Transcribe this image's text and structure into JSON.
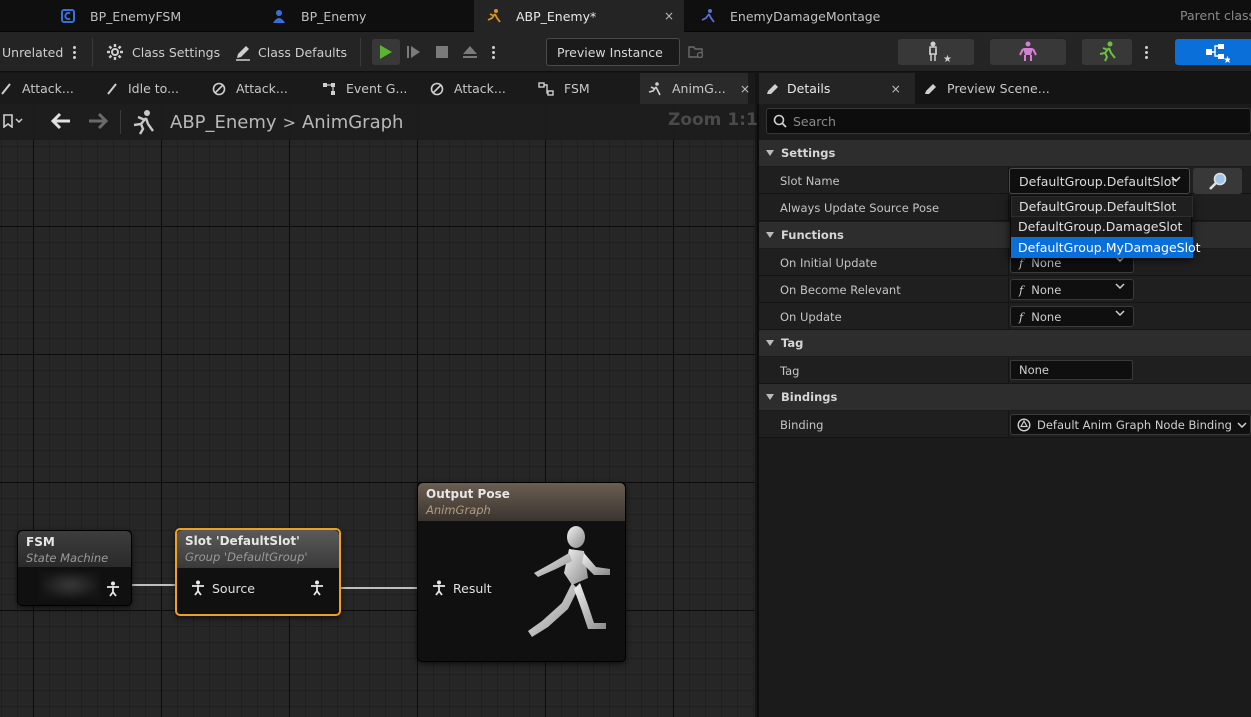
{
  "doc_tabs": [
    {
      "label": "BP_EnemyFSM"
    },
    {
      "label": "BP_Enemy"
    },
    {
      "label": "ABP_Enemy*",
      "close": "×"
    },
    {
      "label": "EnemyDamageMontage"
    }
  ],
  "parent_class": "Parent class",
  "toolbar": {
    "unrelated": "Unrelated",
    "class_settings": "Class Settings",
    "class_defaults": "Class Defaults",
    "preview_instance": "Preview Instance"
  },
  "graph_tabs": [
    {
      "label": "Attack..."
    },
    {
      "label": "Idle to..."
    },
    {
      "label": "Attack..."
    },
    {
      "label": "Event G..."
    },
    {
      "label": "Attack..."
    },
    {
      "label": "FSM"
    },
    {
      "label": "AnimG...",
      "close": "×"
    }
  ],
  "breadcrumb": {
    "root": "ABP_Enemy",
    "sep": ">",
    "leaf": "AnimGraph"
  },
  "zoom": "Zoom 1:1",
  "nodes": {
    "fsm": {
      "title": "FSM",
      "subtitle": "State Machine"
    },
    "slot": {
      "title": "Slot 'DefaultSlot'",
      "subtitle": "Group 'DefaultGroup'",
      "pin": "Source"
    },
    "output": {
      "title": "Output Pose",
      "subtitle": "AnimGraph",
      "pin": "Result"
    }
  },
  "details": {
    "tabs": [
      {
        "label": "Details",
        "close": "×"
      },
      {
        "label": "Preview Scene..."
      }
    ],
    "search_placeholder": "Search",
    "sections": {
      "settings": "Settings",
      "functions": "Functions",
      "tag": "Tag",
      "bindings": "Bindings"
    },
    "props": {
      "slot_name": {
        "label": "Slot Name",
        "value": "DefaultGroup.DefaultSlot"
      },
      "always_update": {
        "label": "Always Update Source Pose"
      },
      "on_initial_update": {
        "label": "On Initial Update",
        "value": "None"
      },
      "on_become_relevant": {
        "label": "On Become Relevant",
        "value": "None"
      },
      "on_update": {
        "label": "On Update",
        "value": "None"
      },
      "tag": {
        "label": "Tag",
        "value": "None"
      },
      "binding": {
        "label": "Binding",
        "value": "Default Anim Graph Node Binding"
      }
    },
    "slot_options": [
      "DefaultGroup.DefaultSlot",
      "DefaultGroup.DamageSlot",
      "DefaultGroup.MyDamageSlot"
    ],
    "selected_option": "DefaultGroup.MyDamageSlot"
  },
  "colors": {
    "accent_blue": "#0a6fd8",
    "selection_orange": "#f0a020",
    "play_green": "#5ab52e"
  }
}
